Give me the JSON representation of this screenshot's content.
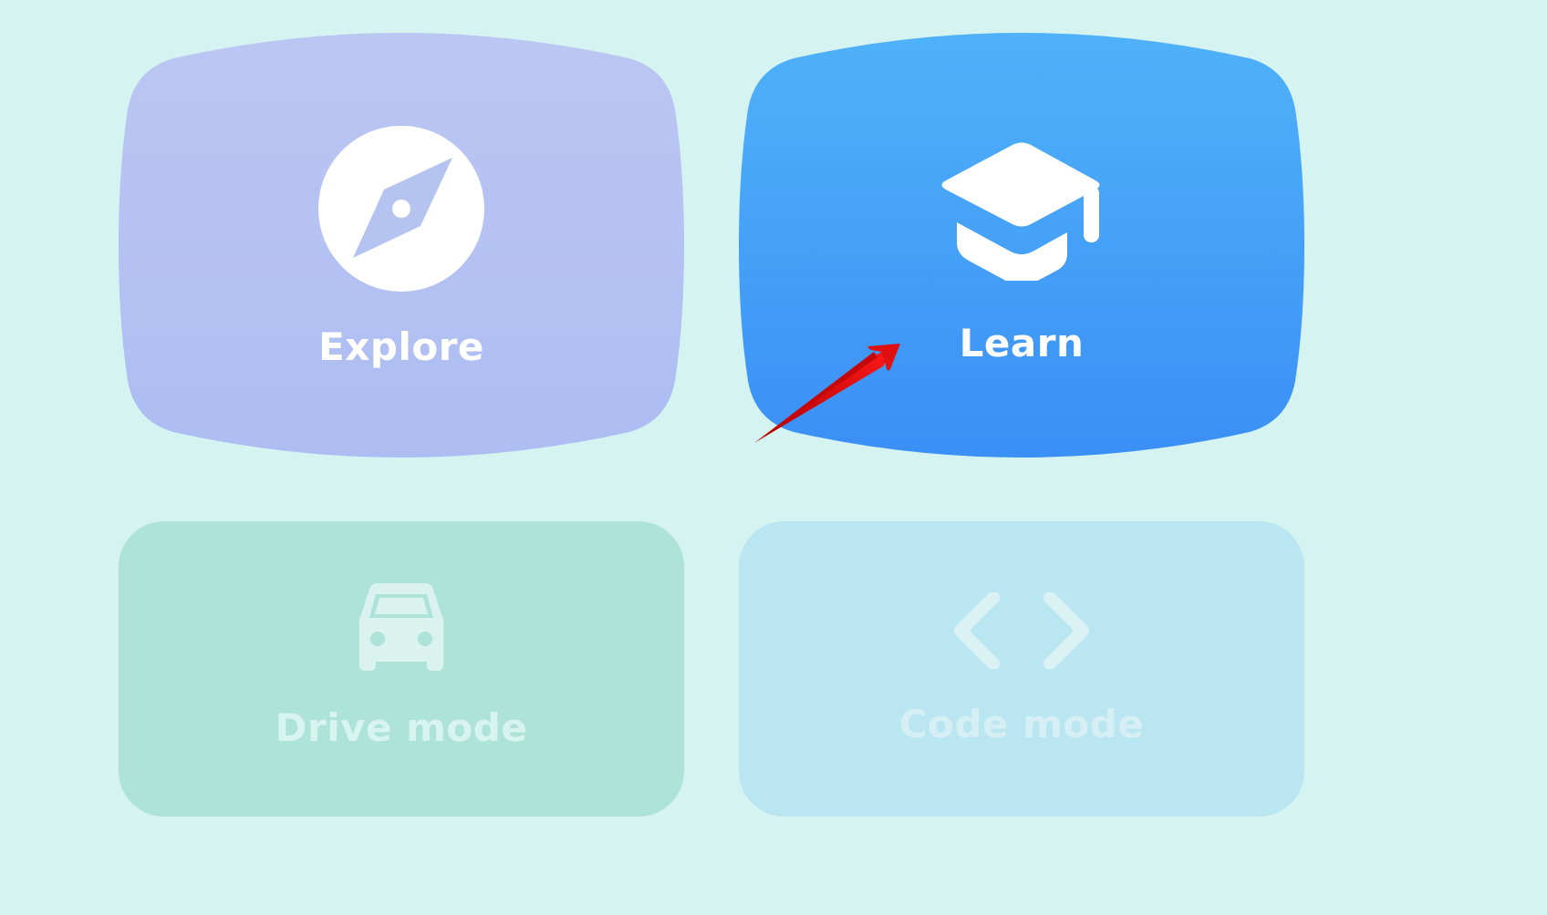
{
  "tiles": {
    "explore": {
      "label": "Explore",
      "icon": "compass-icon",
      "color_top": "#bcc6f2",
      "color_bottom": "#adbdf2"
    },
    "learn": {
      "label": "Learn",
      "icon": "graduation-cap-icon",
      "color_top": "#4fb2f9",
      "color_bottom": "#3b8ff5"
    },
    "drive": {
      "label": "Drive mode",
      "icon": "car-icon",
      "color": "#aee3d7"
    },
    "code": {
      "label": "Code mode",
      "icon": "code-brackets-icon",
      "color": "#bae6f1"
    }
  },
  "annotation": {
    "type": "arrow",
    "color": "#e01010",
    "points_to": "Learn"
  }
}
